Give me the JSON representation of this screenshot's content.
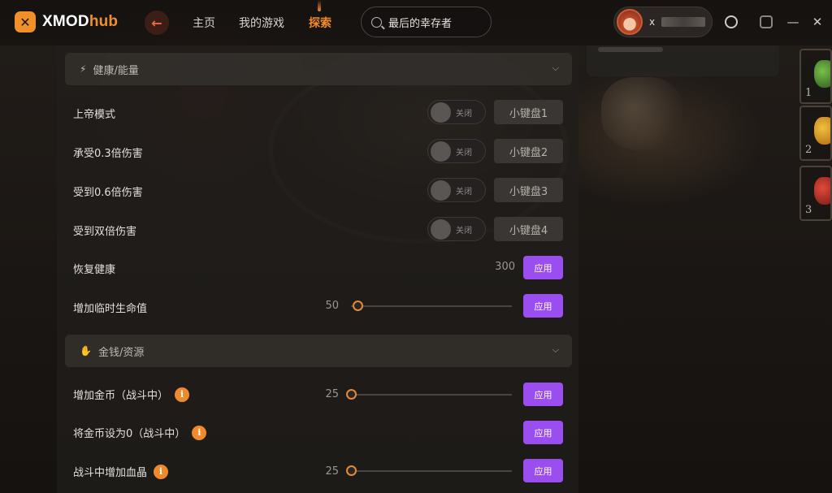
{
  "app": {
    "logo_prefix": "XMOD",
    "logo_suffix": "hub",
    "logo_mark": "✕"
  },
  "nav": {
    "back_icon": "←",
    "items": [
      {
        "label": "主页",
        "active": false
      },
      {
        "label": "我的游戏",
        "active": false
      },
      {
        "label": "探索",
        "active": true
      }
    ]
  },
  "search": {
    "value": "最后的幸存者"
  },
  "user": {
    "name_visible": "x"
  },
  "window_icons": [
    "notification-icon",
    "settings-icon",
    "minimize-icon",
    "close-icon"
  ],
  "window_glyphs": {
    "minimize": "—",
    "close": "✕"
  },
  "sections": [
    {
      "title": "健康/能量",
      "icon": "⚡",
      "rows": [
        {
          "label": "上帝模式",
          "toggle": "关闭",
          "hotkey": "小键盘1"
        },
        {
          "label": "承受0.3倍伤害",
          "toggle": "关闭",
          "hotkey": "小键盘2"
        },
        {
          "label": "受到0.6倍伤害",
          "toggle": "关闭",
          "hotkey": "小键盘3"
        },
        {
          "label": "受到双倍伤害",
          "toggle": "关闭",
          "hotkey": "小键盘4"
        },
        {
          "label": "恢复健康",
          "value": "300",
          "apply": "应用"
        },
        {
          "label": "增加临时生命值",
          "value": "50",
          "apply": "应用"
        }
      ]
    },
    {
      "title": "金钱/资源",
      "icon": "✋",
      "rows": [
        {
          "label": "增加金币（战斗中）",
          "info": "i",
          "value": "25",
          "apply": "应用"
        },
        {
          "label": "将金币设为0（战斗中）",
          "info": "i",
          "apply": "应用"
        },
        {
          "label": "战斗中增加血晶",
          "info": "i",
          "value": "25",
          "apply": "应用"
        }
      ]
    }
  ],
  "inventory_slots": [
    "1",
    "2",
    "3"
  ],
  "colors": {
    "accent": "#f38a2a",
    "apply": "#9b4ef0",
    "info": "#ee8a2c"
  }
}
